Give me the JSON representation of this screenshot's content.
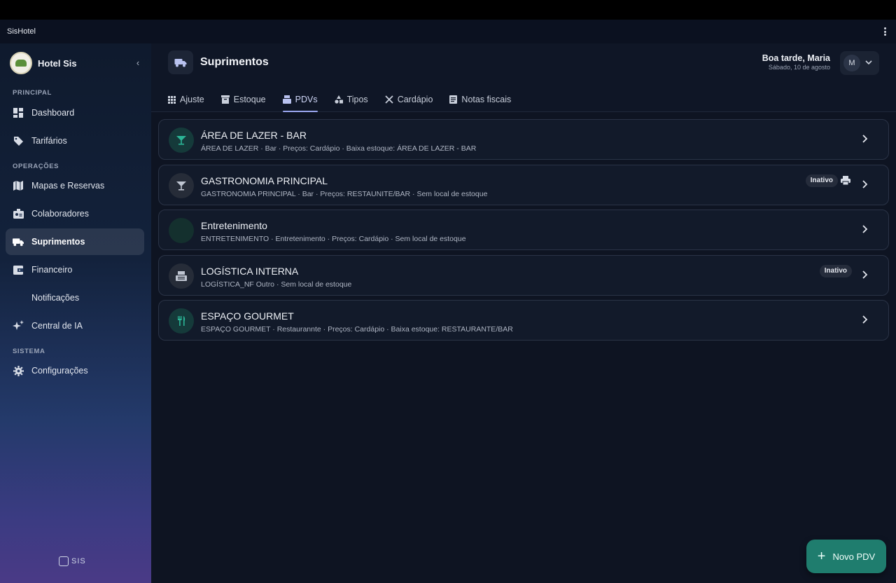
{
  "app": {
    "title": "SisHotel"
  },
  "sidebar": {
    "brand": "Hotel Sis",
    "sections": {
      "principal": "PRINCIPAL",
      "operacoes": "OPERAÇÕES",
      "sistema": "SISTEMA"
    },
    "items": [
      {
        "label": "Dashboard",
        "icon": "dashboard-icon"
      },
      {
        "label": "Tarifários",
        "icon": "tag-icon"
      },
      {
        "label": "Mapas e Reservas",
        "icon": "map-icon"
      },
      {
        "label": "Colaboradores",
        "icon": "badge-icon"
      },
      {
        "label": "Suprimentos",
        "icon": "truck-icon",
        "active": true
      },
      {
        "label": "Financeiro",
        "icon": "wallet-icon"
      },
      {
        "label": "Notificações",
        "icon": ""
      },
      {
        "label": "Central de IA",
        "icon": "sparkle-icon"
      },
      {
        "label": "Configurações",
        "icon": "gear-icon"
      }
    ],
    "footer_logo": "SIS"
  },
  "header": {
    "title": "Suprimentos",
    "greeting": "Boa tarde, Maria",
    "date": "Sábado, 10 de agosto",
    "avatar_initial": "M"
  },
  "tabs": [
    {
      "label": "Ajuste",
      "icon": "grid-icon"
    },
    {
      "label": "Estoque",
      "icon": "box-icon"
    },
    {
      "label": "PDVs",
      "icon": "register-icon",
      "active": true
    },
    {
      "label": "Tipos",
      "icon": "shapes-icon"
    },
    {
      "label": "Cardápio",
      "icon": "cutlery-icon"
    },
    {
      "label": "Notas fiscais",
      "icon": "receipt-icon"
    }
  ],
  "pdvs": [
    {
      "name": "ÁREA DE LAZER - BAR",
      "subtitle": "ÁREA DE LAZER · Bar · Preços: Cardápio · Baixa estoque: ÁREA DE LAZER - BAR",
      "icon": "cocktail-icon",
      "badge": "",
      "printer": false
    },
    {
      "name": "GASTRONOMIA PRINCIPAL",
      "subtitle": "GASTRONOMIA PRINCIPAL · Bar · Preços: RESTAUNITE/BAR · Sem local de estoque",
      "icon": "cocktail-icon",
      "badge": "Inativo",
      "printer": true
    },
    {
      "name": "Entretenimento",
      "subtitle": "ENTRETENIMENTO · Entretenimento · Preços: Cardápio · Sem local de estoque",
      "icon": "",
      "badge": "",
      "printer": false
    },
    {
      "name": "LOGÍSTICA INTERNA",
      "subtitle": "LOGÍSTICA_NF Outro · Sem local de estoque",
      "icon": "register-icon",
      "badge": "Inativo",
      "printer": false
    },
    {
      "name": "ESPAÇO GOURMET",
      "subtitle": "ESPAÇO GOURMET · Restaurannte · Preços: Cardápio · Baixa estoque: RESTAURANTE/BAR",
      "icon": "cutlery-icon",
      "badge": "",
      "printer": false
    }
  ],
  "fab": {
    "label": "Novo PDV"
  },
  "colors": {
    "accent": "#9aa6ee",
    "fab": "#1f7d6e",
    "teal_icon": "#2bb596"
  }
}
